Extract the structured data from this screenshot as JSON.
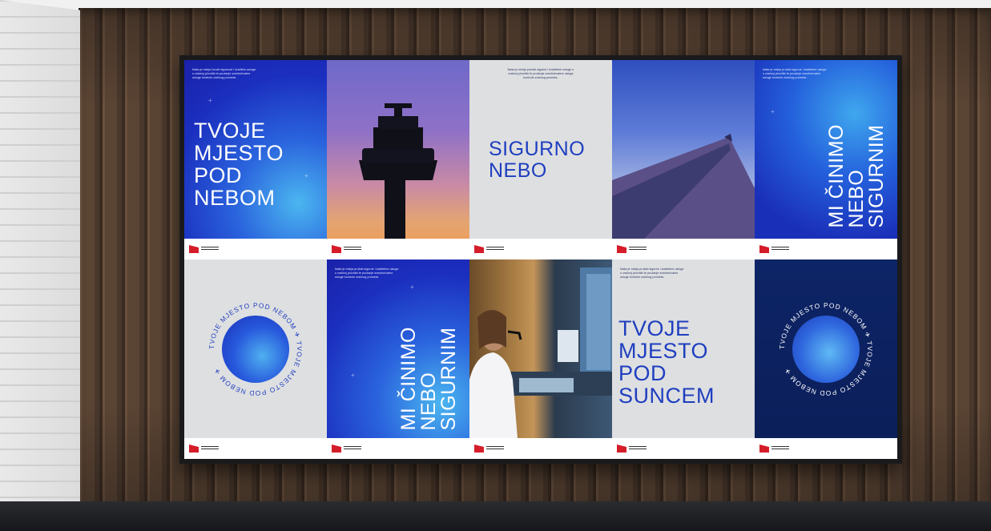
{
  "scene": {
    "description_colors": {
      "accent_blue": "#1f3fbf",
      "logo_red": "#d51d2a",
      "wall_wood": "#5a4434"
    }
  },
  "panels": [
    {
      "id": "p1",
      "headline": "TVOJE\nMJESTO\nPOD\nNEBOM",
      "small": "Naša je misija čuvati sigurnost i kvalitetu usluga u zračnoj plovidbi te pružanje sveobuhvatne usluge kontrole zračnog prometa."
    },
    {
      "id": "p2",
      "photo_icon": "control-tower-silhouette"
    },
    {
      "id": "p3",
      "headline": "SIGURNO\nNEBO",
      "small": "Naša je misija pružati sigurne i kvalitetne usluge u zračnoj plovidbi te pružanje sveobuhvatne usluge kontrole zračnog prometa."
    },
    {
      "id": "p4",
      "photo_icon": "airplane-wing"
    },
    {
      "id": "p5",
      "headline": "MI ČINIMO\nNEBO\nSIGURNIM",
      "small": "Naša je misija pružati sigurne i kvalitetne usluge u zračnoj plovidbi te pružanje sveobuhvatne usluge kontrole zračnog prometa."
    },
    {
      "id": "p6",
      "ring": "TVOJE MJESTO POD NEBOM ✈ TVOJE MJESTO POD NEBOM ✈"
    },
    {
      "id": "p7",
      "headline": "MI ČINIMO\nNEBO\nSIGURNIM",
      "small": "Naša je misija pružati sigurne i kvalitetne usluge u zračnoj plovidbi te pružanje sveobuhvatne usluge kontrole zračnog prometa."
    },
    {
      "id": "p8",
      "photo_icon": "air-traffic-controller"
    },
    {
      "id": "p9",
      "headline": "TVOJE\nMJESTO\nPOD\nSUNCEM",
      "small": "Naša je misija pružati sigurne i kvalitetne usluge u zračnoj plovidbi te pružanje sveobuhvatne usluge kontrole zračnog prometa."
    },
    {
      "id": "p10",
      "ring": "TVOJE MJESTO POD NEBOM ✈ TVOJE MJESTO POD NEBOM ✈"
    }
  ]
}
